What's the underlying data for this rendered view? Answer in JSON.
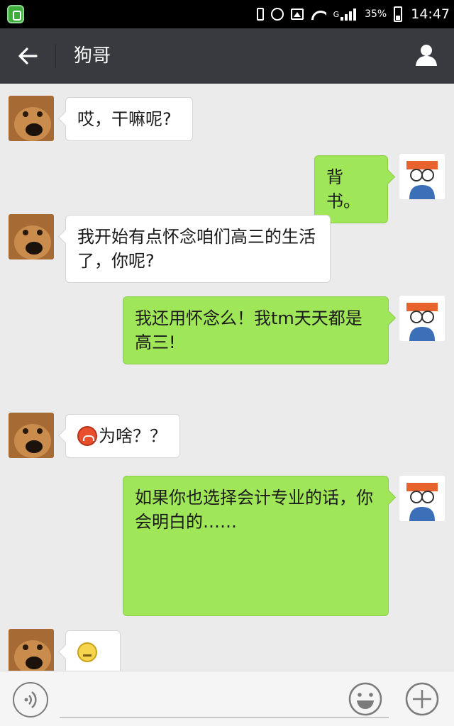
{
  "status_bar": {
    "icons": [
      "app-shield-icon",
      "vibrate-icon",
      "alarm-icon",
      "image-icon",
      "wifi-icon",
      "signal-icon",
      "battery-icon"
    ],
    "network_label": "G",
    "battery": "35%",
    "time": "14:47"
  },
  "header": {
    "title": "狗哥",
    "back_icon": "arrow-left-icon",
    "profile_icon": "person-icon"
  },
  "messages": [
    {
      "side": "in",
      "text": "哎，干嘛呢?"
    },
    {
      "side": "out",
      "text": "背书。"
    },
    {
      "side": "in",
      "text": "我开始有点怀念咱们高三的生活了，你呢?"
    },
    {
      "side": "out",
      "text": "我还用怀念么！我tm天天都是高三!"
    },
    {
      "side": "in",
      "emoji": "angry-face-icon",
      "text": "为啥？？"
    },
    {
      "side": "out",
      "text": "如果你也选择会计专业的话，你会明白的……"
    },
    {
      "side": "in",
      "emoji": "sweat-face-icon",
      "text": "..."
    }
  ],
  "input_bar": {
    "voice_icon": "voice-icon",
    "emoji_icon": "smiley-icon",
    "plus_icon": "plus-icon",
    "placeholder": ""
  },
  "colors": {
    "header_bg": "#393a3f",
    "chat_bg": "#ebebeb",
    "outgoing_bubble": "#9fe658",
    "incoming_bubble": "#ffffff"
  }
}
